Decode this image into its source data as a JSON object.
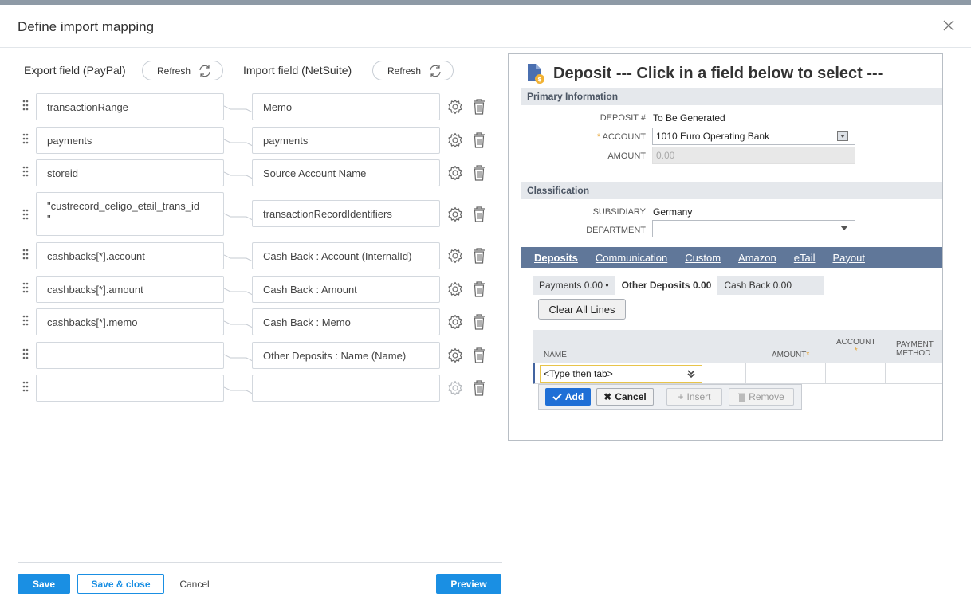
{
  "dialog": {
    "title": "Define import mapping"
  },
  "export_col": {
    "title": "Export field (PayPal)",
    "refresh_label": "Refresh"
  },
  "import_col": {
    "title": "Import field (NetSuite)",
    "refresh_label": "Refresh"
  },
  "mappings": [
    {
      "export": "transactionRange",
      "import": "Memo"
    },
    {
      "export": "payments",
      "import": "payments"
    },
    {
      "export": "storeid",
      "import": "Source Account Name"
    },
    {
      "export": "\"custrecord_celigo_etail_trans_id\n\"",
      "import": "transactionRecordIdentifiers"
    },
    {
      "export": "cashbacks[*].account",
      "import": "Cash Back : Account (InternalId)"
    },
    {
      "export": "cashbacks[*].amount",
      "import": "Cash Back : Amount"
    },
    {
      "export": "cashbacks[*].memo",
      "import": "Cash Back : Memo"
    },
    {
      "export": "",
      "import": "Other Deposits : Name (Name)"
    },
    {
      "export": "",
      "import": ""
    }
  ],
  "footer": {
    "save": "Save",
    "save_close": "Save & close",
    "cancel": "Cancel",
    "preview": "Preview"
  },
  "netsuite": {
    "title": "Deposit --- Click in a field below to select ---",
    "primary_section": "Primary Information",
    "deposit_label": "DEPOSIT #",
    "deposit_value": "To Be Generated",
    "account_label": "ACCOUNT",
    "account_value": "1010 Euro Operating Bank",
    "amount_label": "AMOUNT",
    "amount_value": "0.00",
    "classification_section": "Classification",
    "subsidiary_label": "SUBSIDIARY",
    "subsidiary_value": "Germany",
    "department_label": "DEPARTMENT",
    "department_value": "",
    "tabs": [
      "Deposits",
      "Communication",
      "Custom",
      "Amazon",
      "eTail",
      "Payout"
    ],
    "subtabs": [
      "Payments 0.00 •",
      "Other Deposits 0.00",
      "Cash Back 0.00"
    ],
    "clear_all": "Clear All Lines",
    "grid_cols": {
      "name": "NAME",
      "amount": "AMOUNT",
      "account": "ACCOUNT",
      "payment_method_1": "PAYMENT",
      "payment_method_2": "METHOD"
    },
    "name_placeholder": "<Type then tab>",
    "btn_add": "Add",
    "btn_cancel": "Cancel",
    "btn_insert": "Insert",
    "btn_remove": "Remove"
  },
  "colors": {
    "primary": "#1a8fe3",
    "ns_tabbar": "#607799",
    "ns_section": "#e5e8ec",
    "required": "#e5a02b"
  }
}
